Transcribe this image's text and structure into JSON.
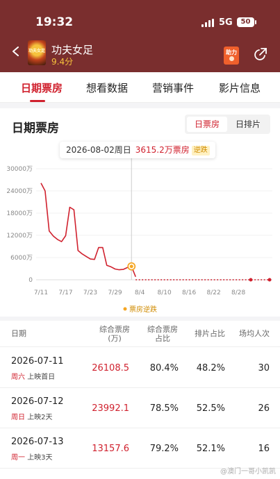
{
  "status_bar": {
    "time": "19:32",
    "network": "5G",
    "battery": "50"
  },
  "header": {
    "movie_title": "功夫女足",
    "score": "9.4分",
    "poster_text": "功夫女足",
    "boost_label": "助力"
  },
  "tabs": [
    {
      "label": "日期票房",
      "active": true
    },
    {
      "label": "想看数据",
      "active": false
    },
    {
      "label": "营销事件",
      "active": false
    },
    {
      "label": "影片信息",
      "active": false
    }
  ],
  "card": {
    "title": "日期票房",
    "toggle": {
      "selected": "日票房",
      "other": "日排片"
    },
    "tooltip": {
      "date": "2026-08-02周日",
      "value": "3615.2万票房",
      "tag": "逆跌"
    },
    "legend": "票房逆跌"
  },
  "chart_data": {
    "type": "line",
    "y_ticks": [
      "30000万",
      "24000万",
      "18000万",
      "12000万",
      "6000万",
      "0"
    ],
    "ylim": [
      0,
      30000
    ],
    "x_ticks": [
      "7/11",
      "7/17",
      "7/23",
      "7/29",
      "8/4",
      "8/10",
      "8/16",
      "8/22",
      "8/28"
    ],
    "series": [
      {
        "color": "#d0212e",
        "points": [
          [
            "7/11",
            26108.5
          ],
          [
            "7/12",
            23992.1
          ],
          [
            "7/13",
            13157.6
          ],
          [
            "7/14",
            11800
          ],
          [
            "7/15",
            10900
          ],
          [
            "7/16",
            10300
          ],
          [
            "7/17",
            11900
          ],
          [
            "7/18",
            19600
          ],
          [
            "7/19",
            18900
          ],
          [
            "7/20",
            7900
          ],
          [
            "7/21",
            7000
          ],
          [
            "7/22",
            6300
          ],
          [
            "7/23",
            5600
          ],
          [
            "7/24",
            5500
          ],
          [
            "7/25",
            8700
          ],
          [
            "7/26",
            8700
          ],
          [
            "7/27",
            3900
          ],
          [
            "7/28",
            3500
          ],
          [
            "7/29",
            2900
          ],
          [
            "7/30",
            2700
          ],
          [
            "7/31",
            2800
          ],
          [
            "8/1",
            3300
          ],
          [
            "8/2",
            3615.2
          ],
          [
            "8/3",
            800
          ]
        ]
      }
    ],
    "highlight": {
      "x": "8/2",
      "value": 3615.2,
      "color": "#f5a623"
    },
    "projection_color": "#d0212e"
  },
  "table": {
    "headers": [
      "日期",
      "综合票房\n(万)",
      "综合票房\n占比",
      "排片占比",
      "场均人次"
    ],
    "rows": [
      {
        "date": "2026-07-11",
        "weekday": "周六",
        "note": "上映首日",
        "gross": "26108.5",
        "share": "80.4%",
        "screen": "48.2%",
        "avg": "30"
      },
      {
        "date": "2026-07-12",
        "weekday": "周日",
        "note": "上映2天",
        "gross": "23992.1",
        "share": "78.5%",
        "screen": "52.5%",
        "avg": "26"
      },
      {
        "date": "2026-07-13",
        "weekday": "周一",
        "note": "上映3天",
        "gross": "13157.6",
        "share": "79.2%",
        "screen": "52.1%",
        "avg": "16"
      }
    ]
  },
  "watermark": "@澳门一哥小凯凯",
  "icons": [
    "back-icon",
    "share-icon",
    "signal-icon",
    "battery-icon"
  ]
}
